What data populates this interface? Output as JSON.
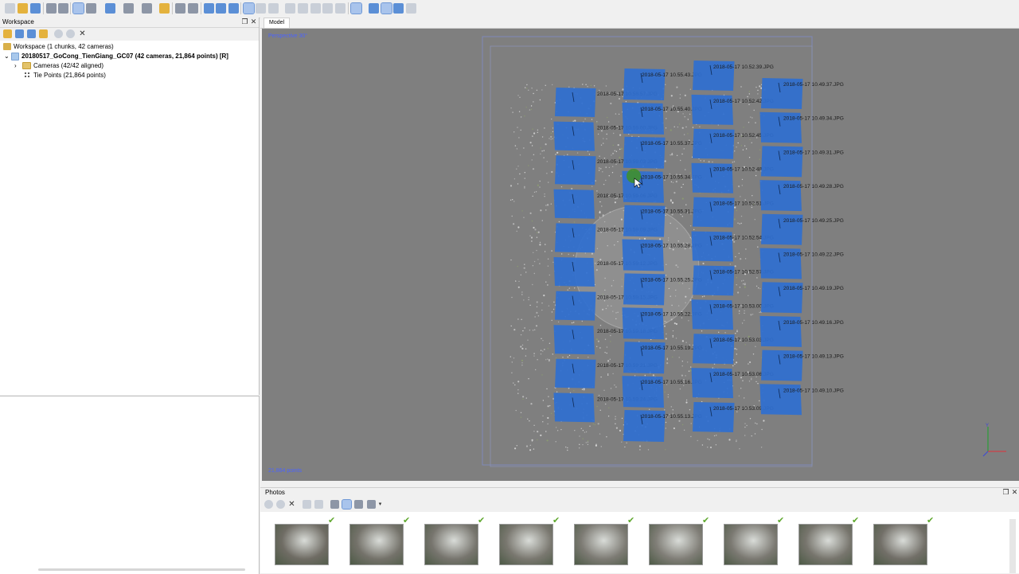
{
  "model": {
    "tab_label": "Model",
    "perspective_label": "Perspective 30°",
    "points_label": "21,864 points",
    "camera_color": "#2f6fd0",
    "columns": [
      {
        "labels": [
          "2018-05-17 10.58.57.JPG",
          "2018-05-17 10.59.00.JPG",
          "2018-05-17 10.59.03.JPG",
          "2018-05-17 10.59.06.JPG",
          "2018-05-17 10.59.09.JPG",
          "2018-05-17 10.59.12.JPG",
          "2018-05-17 10.59.15.JPG",
          "2018-05-17 10.59.18.JPG",
          "2018-05-17 10.59.21.JPG",
          "2018-05-17 10.59.24.JPG"
        ]
      },
      {
        "labels": [
          "2018-05-17 10.55.43.JPG",
          "2018-05-17 10.55.40.JPG",
          "2018-05-17 10.55.37.JPG",
          "2018-05-17 10.55.34.JPG",
          "2018-05-17 10.55.31.JPG",
          "2018-05-17 10.55.28.JPG",
          "2018-05-17 10.55.25.JPG",
          "2018-05-17 10.55.22.JPG",
          "2018-05-17 10.55.19.JPG",
          "2018-05-17 10.55.16.JPG",
          "2018-05-17 10.55.13.JPG"
        ]
      },
      {
        "labels": [
          "2018-05-17 10.52.39.JPG",
          "2018-05-17 10.52.42.JPG",
          "2018-05-17 10.52.45.JPG",
          "2018-05-17 10.52.48.JPG",
          "2018-05-17 10.52.51.JPG",
          "2018-05-17 10.52.54.JPG",
          "2018-05-17 10.52.57.JPG",
          "2018-05-17 10.53.00.JPG",
          "2018-05-17 10.53.03.JPG",
          "2018-05-17 10.53.06.JPG",
          "2018-05-17 10.53.09.JPG"
        ]
      },
      {
        "labels": [
          "2018-05-17 10.49.37.JPG",
          "2018-05-17 10.49.34.JPG",
          "2018-05-17 10.49.31.JPG",
          "2018-05-17 10.49.28.JPG",
          "2018-05-17 10.49.25.JPG",
          "2018-05-17 10.49.22.JPG",
          "2018-05-17 10.49.19.JPG",
          "2018-05-17 10.49.16.JPG",
          "2018-05-17 10.49.13.JPG",
          "2018-05-17 10.49.10.JPG"
        ]
      }
    ]
  },
  "workspace": {
    "title": "Workspace",
    "root_label": "Workspace (1 chunks, 42 cameras)",
    "chunk_label": "20180517_GoCong_TienGiang_GC07 (42 cameras, 21,864 points) [R]",
    "cameras_label": "Cameras (42/42 aligned)",
    "tiepoints_label": "Tie Points (21,864 points)"
  },
  "photos": {
    "title": "Photos",
    "thumbnails": [
      {
        "tone": "#6f6c64"
      },
      {
        "tone": "#74726a"
      },
      {
        "tone": "#77756e"
      },
      {
        "tone": "#7a7870"
      },
      {
        "tone": "#7d7b74"
      },
      {
        "tone": "#807e77"
      },
      {
        "tone": "#7b7972"
      },
      {
        "tone": "#77756d"
      },
      {
        "tone": "#726f68"
      }
    ]
  }
}
